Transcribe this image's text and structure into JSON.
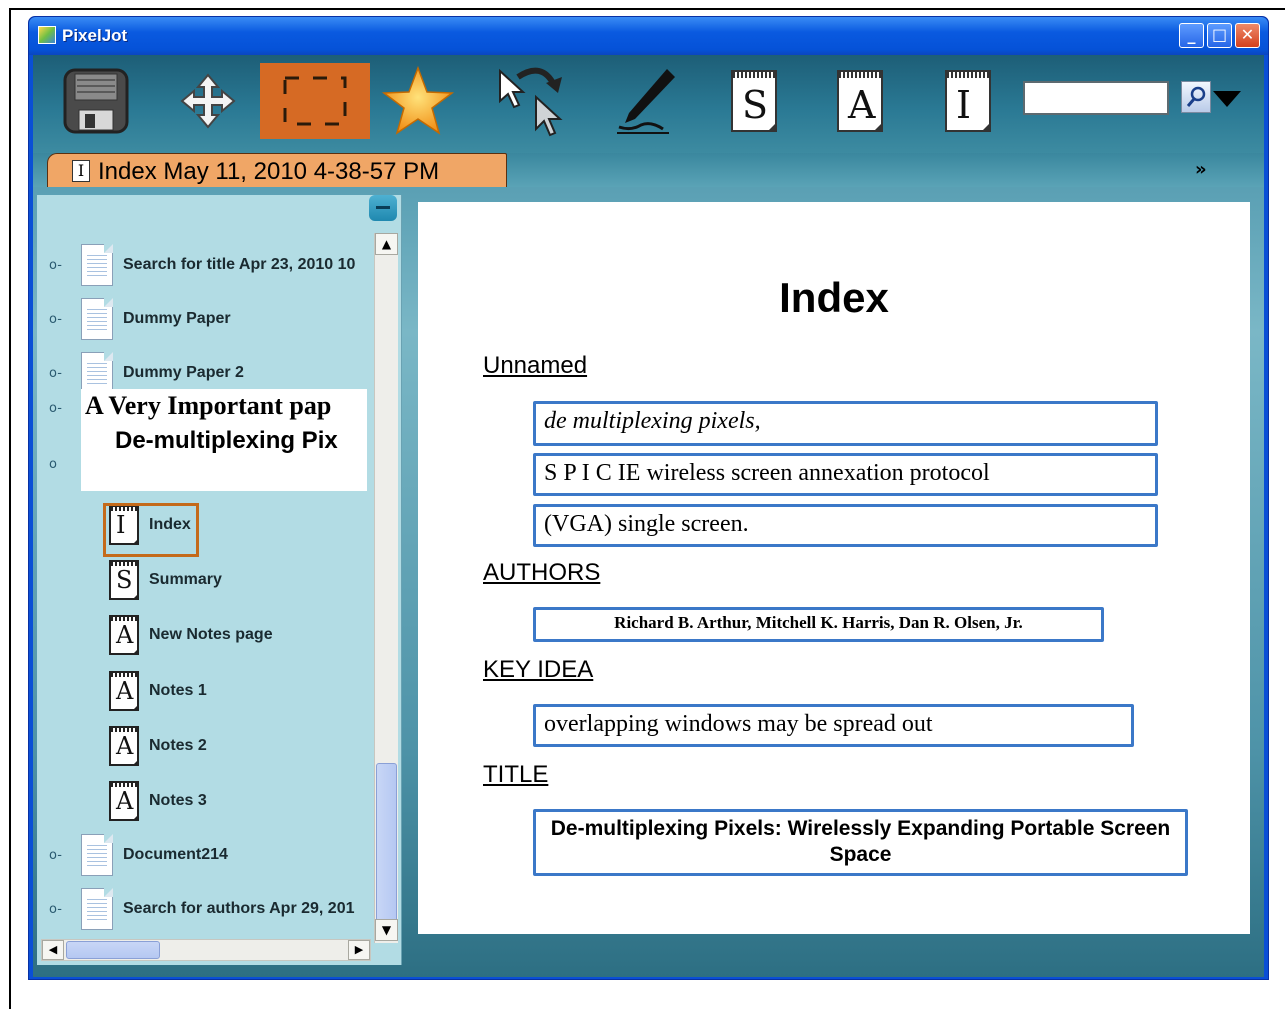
{
  "app": {
    "title": "PixelJot"
  },
  "window_controls": {
    "minimize": "_",
    "maximize": "□",
    "close": "✕"
  },
  "toolbar": {
    "buttons": [
      {
        "name": "save",
        "icon": "floppy-disk-icon"
      },
      {
        "name": "move",
        "icon": "move-arrows-icon"
      },
      {
        "name": "select",
        "icon": "selection-rectangle-icon",
        "active": true
      },
      {
        "name": "favorite",
        "icon": "star-icon"
      },
      {
        "name": "redo-pointer",
        "icon": "pointer-redo-icon"
      },
      {
        "name": "pen",
        "icon": "pen-icon"
      },
      {
        "name": "summary",
        "icon": "summary-page-icon",
        "letter": "S"
      },
      {
        "name": "annotate",
        "icon": "notes-page-icon",
        "letter": "A"
      },
      {
        "name": "index",
        "icon": "index-page-icon",
        "letter": "I"
      }
    ],
    "search_value": "",
    "accent_color": "#d66a24"
  },
  "tab": {
    "letter": "I",
    "title": "Index May 11, 2010 4-38-57 PM",
    "overflow": "»"
  },
  "tree": {
    "items": [
      {
        "label": "Search for title Apr 23, 2010 10"
      },
      {
        "label": "Dummy Paper"
      },
      {
        "label": "Dummy Paper 2"
      }
    ],
    "open_item": {
      "line1": "A Very Important pap",
      "line2": "De-multiplexing Pix"
    },
    "children": [
      {
        "letter": "I",
        "label": "Index",
        "selected": true
      },
      {
        "letter": "S",
        "label": "Summary"
      },
      {
        "letter": "A",
        "label": "New Notes page"
      },
      {
        "letter": "A",
        "label": "Notes 1"
      },
      {
        "letter": "A",
        "label": "Notes 2"
      },
      {
        "letter": "A",
        "label": "Notes 3"
      }
    ],
    "after": [
      {
        "label": "Document214"
      },
      {
        "label": "Search for authors Apr 29, 201"
      }
    ]
  },
  "page": {
    "title": "Index",
    "sections": {
      "unnamed": {
        "label": "Unnamed",
        "items": [
          "de multiplexing pixels,",
          "S P I C IE wireless screen annexation protocol",
          "(VGA) single screen."
        ]
      },
      "authors": {
        "label": "AUTHORS",
        "value": "Richard B. Arthur, Mitchell K. Harris, Dan R. Olsen, Jr."
      },
      "key_idea": {
        "label": "KEY IDEA",
        "value": "overlapping windows may be spread out"
      },
      "title": {
        "label": "TITLE",
        "value": "De-multiplexing Pixels: Wirelessly Expanding Portable Screen Space"
      }
    }
  },
  "colors": {
    "field_border": "#3b78c8",
    "tab": "#f0a666",
    "selection": "#c46a1a"
  }
}
